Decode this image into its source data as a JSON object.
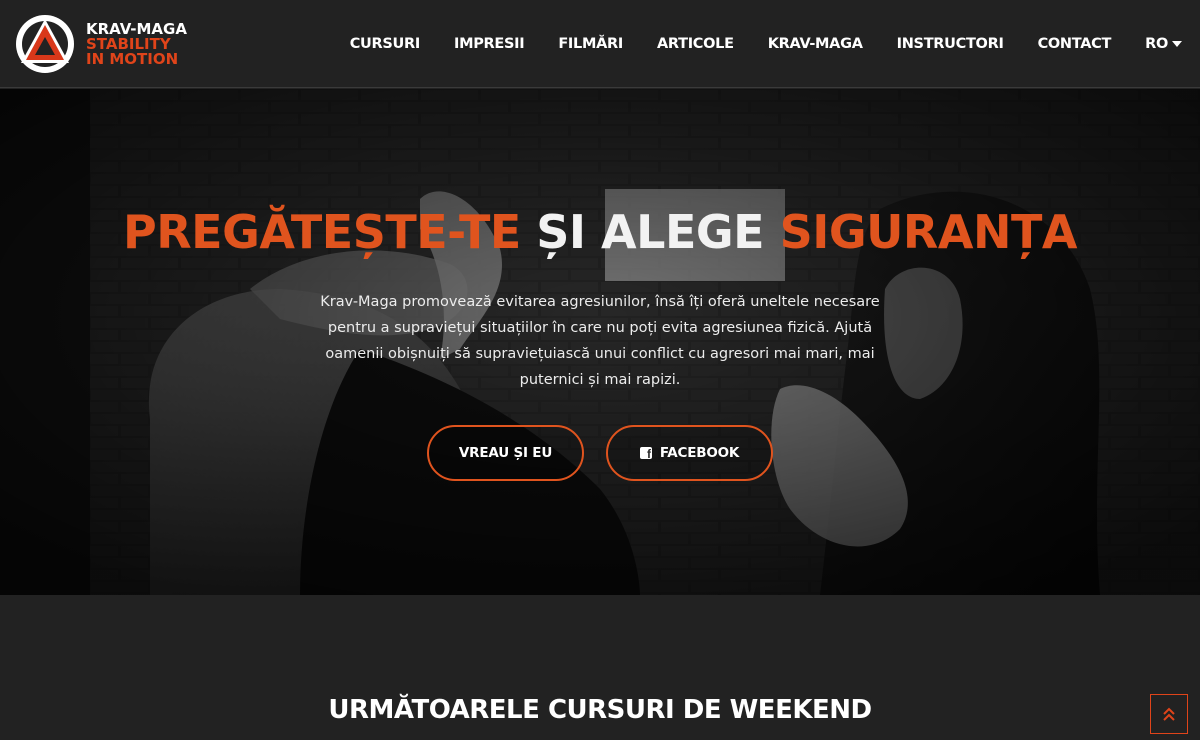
{
  "brand": {
    "line1": "KRAV-MAGA",
    "line2": "STABILITY",
    "line3": "IN MOTION",
    "logo_icon": "triangle-in-circle-icon",
    "accent_color": "#e0441a"
  },
  "nav": {
    "items": [
      "CURSURI",
      "IMPRESII",
      "FILMĂRI",
      "ARTICOLE",
      "KRAV-MAGA",
      "INSTRUCTORI",
      "CONTACT"
    ],
    "language": "RO"
  },
  "hero": {
    "headline_part1": "PREGĂTEȘTE-TE",
    "headline_part2": "ȘI ALEGE",
    "headline_part3": "SIGURANȚA",
    "lead": "Krav-Maga promovează evitarea agresiunilor, însă îți oferă uneltele necesare pentru a supraviețui situațiilor în care nu poți evita agresiunea fizică. Ajută oamenii obișnuiți să supraviețuiască unui conflict cu agresori mai mari, mai puternici și mai rapizi.",
    "button_join": "VREAU ȘI EU",
    "button_facebook": "FACEBOOK",
    "facebook_icon": "facebook-square-icon",
    "accent_color": "#e0541e"
  },
  "section": {
    "title": "URMĂTOARELE CURSURI DE WEEKEND"
  },
  "back_to_top_icon": "double-chevron-up-icon"
}
